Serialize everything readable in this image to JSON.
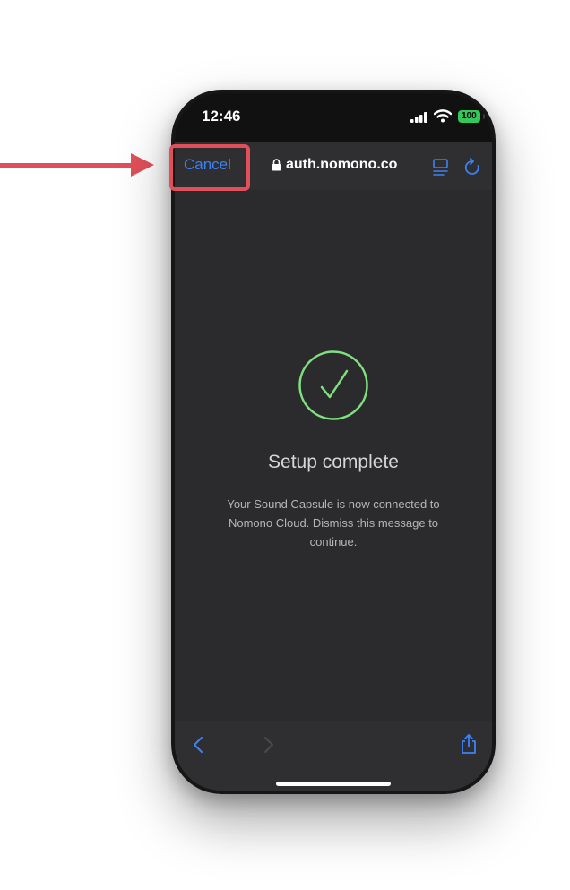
{
  "status_bar": {
    "time": "12:46",
    "battery": "100"
  },
  "browser": {
    "cancel_label": "Cancel",
    "url": "auth.nomono.co"
  },
  "content": {
    "title": "Setup complete",
    "message": "Your Sound Capsule is now connected to Nomono Cloud. Dismiss this message to continue."
  },
  "icons": {
    "lock": "lock-icon",
    "reader": "reader-icon",
    "reload": "reload-icon",
    "back": "chevron-left-icon",
    "forward": "chevron-right-icon",
    "share": "share-icon",
    "success": "checkmark-circle-icon"
  },
  "colors": {
    "accent": "#3b82f6",
    "success": "#7ee07e",
    "annotation": "#e0505a",
    "battery": "#34c759"
  }
}
